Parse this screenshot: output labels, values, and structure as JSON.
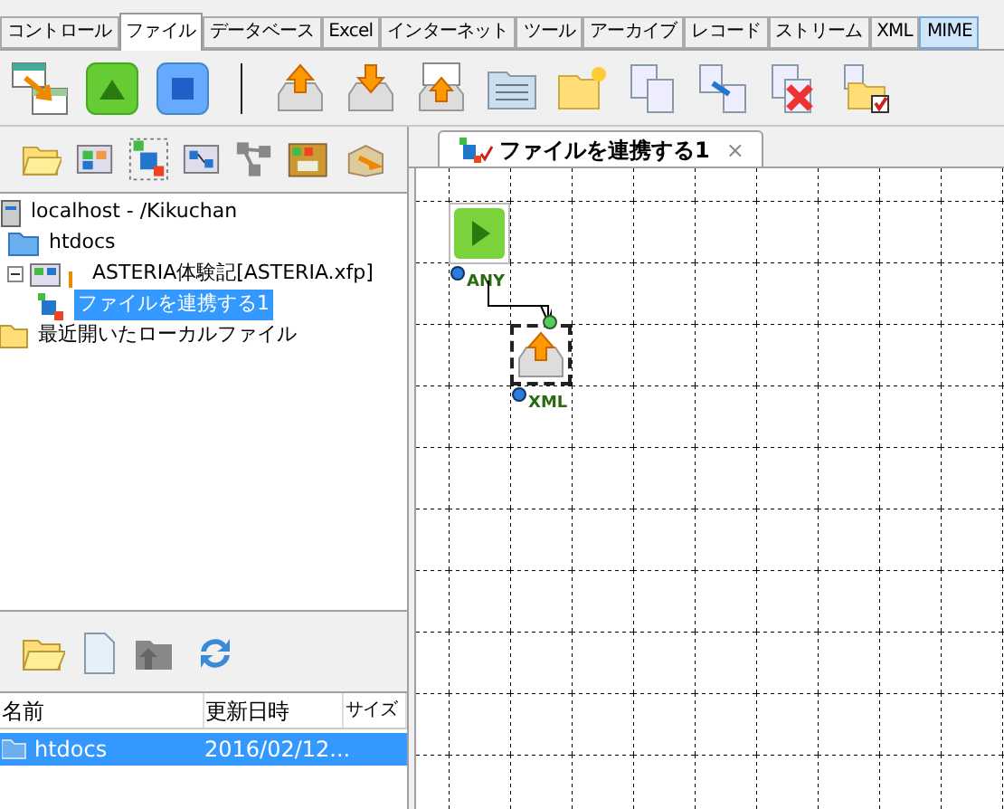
{
  "menu_tabs": [
    {
      "label": "コントロール",
      "selected": false,
      "highlighted": false
    },
    {
      "label": "ファイル",
      "selected": true,
      "highlighted": false
    },
    {
      "label": "データベース",
      "selected": false,
      "highlighted": false
    },
    {
      "label": "Excel",
      "selected": false,
      "highlighted": false
    },
    {
      "label": "インターネット",
      "selected": false,
      "highlighted": false
    },
    {
      "label": "ツール",
      "selected": false,
      "highlighted": false
    },
    {
      "label": "アーカイブ",
      "selected": false,
      "highlighted": false
    },
    {
      "label": "レコード",
      "selected": false,
      "highlighted": false
    },
    {
      "label": "ストリーム",
      "selected": false,
      "highlighted": false
    },
    {
      "label": "XML",
      "selected": false,
      "highlighted": false
    },
    {
      "label": "MIME",
      "selected": false,
      "highlighted": true
    }
  ],
  "tree": [
    {
      "label": "localhost - /Kikuchan",
      "kind": "server",
      "selected": false,
      "children": [
        {
          "label": "htdocs",
          "kind": "folder",
          "selected": false
        },
        {
          "label": "ASTERIA体験記[ASTERIA.xfp]",
          "kind": "project",
          "selected": false,
          "expanded": true,
          "children": [
            {
              "label": "ファイルを連携する1",
              "kind": "flow",
              "selected": true
            }
          ]
        }
      ]
    },
    {
      "label": "最近開いたローカルファイル",
      "kind": "folder",
      "selected": false
    }
  ],
  "file_list": {
    "columns": [
      "名前",
      "更新日時",
      "サイズ"
    ],
    "rows": [
      {
        "name": "htdocs",
        "modified": "2016/02/12...",
        "selected": true
      }
    ]
  },
  "editor_tab": {
    "label": "ファイルを連携する1",
    "close": "×"
  },
  "canvas": {
    "nodes": [
      {
        "kind": "start",
        "selected": false,
        "port": "ANY"
      },
      {
        "kind": "file-put",
        "selected": true,
        "port": "XML"
      }
    ]
  }
}
